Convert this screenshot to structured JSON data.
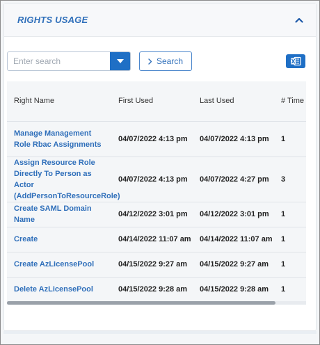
{
  "panel": {
    "title": "RIGHTS USAGE",
    "collapse_icon": "chevron-up-icon"
  },
  "search": {
    "placeholder": "Enter search",
    "value": "",
    "dropdown_icon": "caret-down-icon",
    "button_label": "Search",
    "button_icon": "chevron-right-icon"
  },
  "export": {
    "icon": "excel-icon"
  },
  "table": {
    "headers": [
      "Right Name",
      "First Used",
      "Last Used",
      "# Time"
    ],
    "rows": [
      {
        "name": "Manage Management Role Rbac Assignments",
        "first_used": "04/07/2022 4:13 pm",
        "last_used": "04/07/2022 4:13 pm",
        "count": "1"
      },
      {
        "name": "Assign Resource Role Directly To Person as Actor (AddPersonToResourceRole)",
        "first_used": "04/07/2022 4:13 pm",
        "last_used": "04/07/2022 4:27 pm",
        "count": "3"
      },
      {
        "name": "Create SAML Domain Name",
        "first_used": "04/12/2022 3:01 pm",
        "last_used": "04/12/2022 3:01 pm",
        "count": "1"
      },
      {
        "name": "Create",
        "first_used": "04/14/2022 11:07 am",
        "last_used": "04/14/2022 11:07 am",
        "count": "1"
      },
      {
        "name": "Create AzLicensePool",
        "first_used": "04/15/2022 9:27 am",
        "last_used": "04/15/2022 9:27 am",
        "count": "1"
      },
      {
        "name": "Delete AzLicensePool",
        "first_used": "04/15/2022 9:28 am",
        "last_used": "04/15/2022 9:28 am",
        "count": "1"
      }
    ]
  },
  "colors": {
    "accent": "#2f6fba",
    "button_fill": "#1f6fc5",
    "table_bg": "#f4f6f8"
  }
}
